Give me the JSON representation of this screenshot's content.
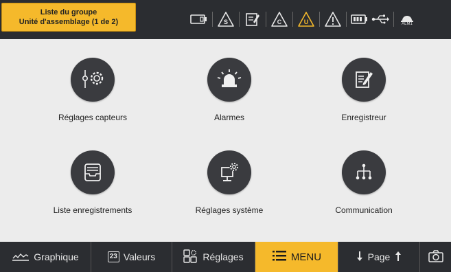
{
  "header": {
    "group_title": "Liste du groupe",
    "group_subtitle": "Unité d'assemblage (1 de 2)"
  },
  "status_icons": [
    {
      "name": "battery-compartment-icon"
    },
    {
      "name": "warning-s-icon",
      "letter": "S"
    },
    {
      "name": "recorder-edit-icon"
    },
    {
      "name": "warning-c-icon",
      "letter": "C"
    },
    {
      "name": "warning-u-icon",
      "letter": "U"
    },
    {
      "name": "warning-icon",
      "letter": "!"
    },
    {
      "name": "battery-level-icon"
    },
    {
      "name": "usb-icon"
    },
    {
      "name": "alarm-indicator-icon",
      "label": "ALM1"
    }
  ],
  "menu": {
    "items": [
      {
        "label": "Réglages capteurs",
        "icon": "sensor-settings-icon"
      },
      {
        "label": "Alarmes",
        "icon": "alarm-siren-icon"
      },
      {
        "label": "Enregistreur",
        "icon": "recorder-icon"
      },
      {
        "label": "Liste enregistrements",
        "icon": "records-tray-icon"
      },
      {
        "label": "Réglages système",
        "icon": "system-settings-icon"
      },
      {
        "label": "Communication",
        "icon": "network-icon"
      }
    ]
  },
  "bottom_nav": {
    "graphique": "Graphique",
    "valeurs_badge": "23",
    "valeurs": "Valeurs",
    "reglages": "Réglages",
    "menu": "MENU",
    "page": "Page"
  },
  "colors": {
    "accent": "#f5b92b",
    "bar_bg": "#2b2d31",
    "icon_circle": "#3a3b3f",
    "background": "#ececec"
  }
}
